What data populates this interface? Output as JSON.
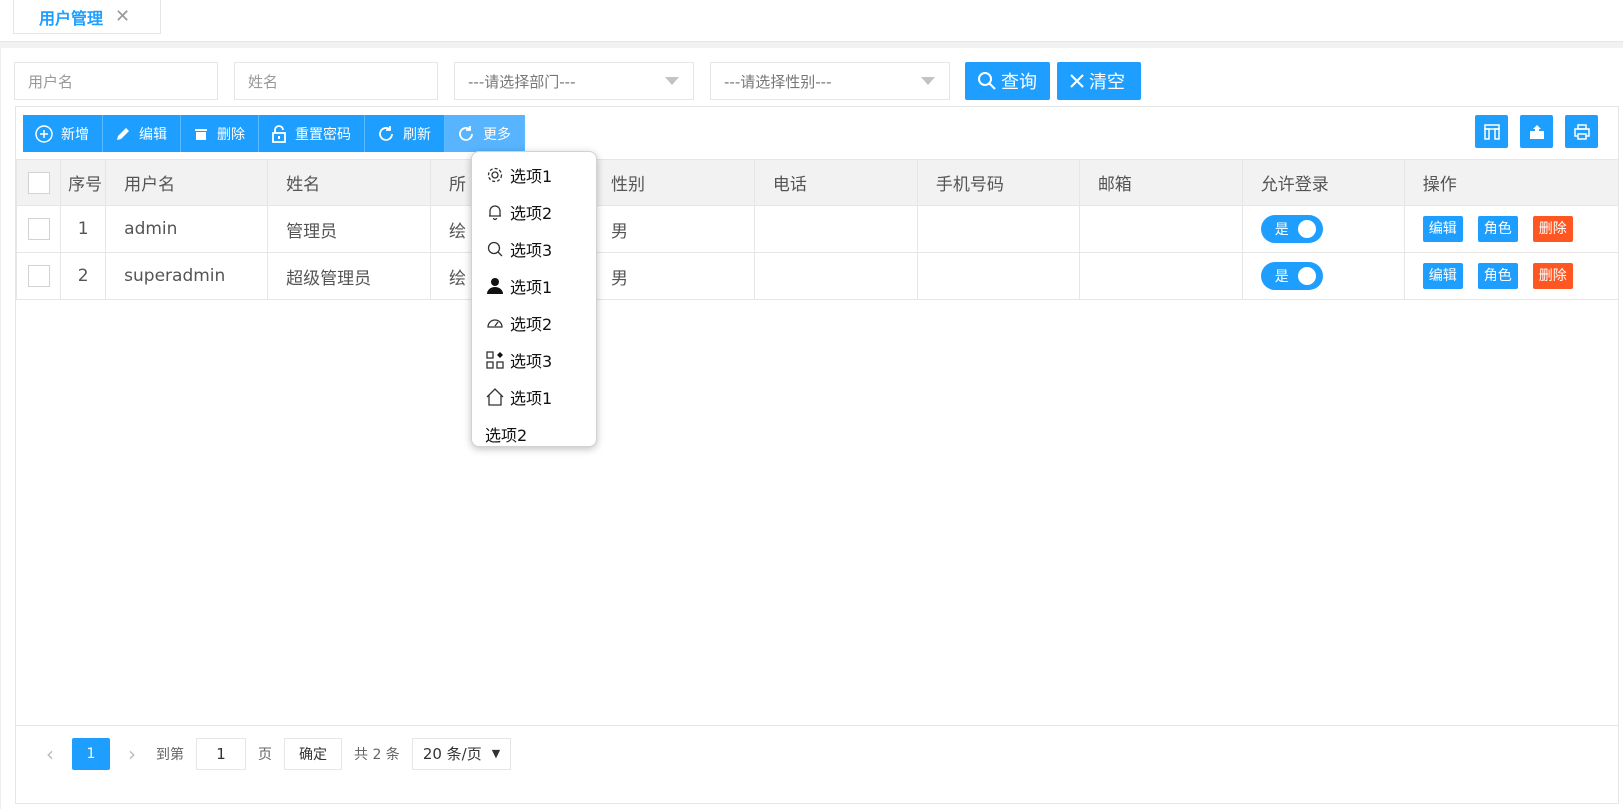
{
  "tabs": [
    {
      "label": "用户管理",
      "close": "✕"
    }
  ],
  "filters": {
    "username_placeholder": "用户名",
    "name_placeholder": "姓名",
    "department_select": "---请选择部门---",
    "gender_select": "---请选择性别---",
    "query_label": "查询",
    "clear_label": "清空"
  },
  "toolbar": {
    "add": "新增",
    "edit": "编辑",
    "delete": "删除",
    "reset_pwd": "重置密码",
    "refresh": "刷新",
    "more": "更多"
  },
  "table": {
    "headers": [
      "序号",
      "用户名",
      "姓名",
      "所",
      "性别",
      "电话",
      "手机号码",
      "邮箱",
      "允许登录",
      "操作"
    ],
    "rows": [
      {
        "index": "1",
        "username": "admin",
        "name": "管理员",
        "dept": "绘",
        "gender": "男",
        "phone": "",
        "mobile": "",
        "email": "",
        "login": "是"
      },
      {
        "index": "2",
        "username": "superadmin",
        "name": "超级管理员",
        "dept": "绘",
        "gender": "男",
        "phone": "",
        "mobile": "",
        "email": "",
        "login": "是"
      }
    ],
    "op_edit": "编辑",
    "op_role": "角色",
    "op_delete": "删除"
  },
  "dropdown": [
    {
      "icon": "gear-icon",
      "label": "选项1"
    },
    {
      "icon": "bell-icon",
      "label": "选项2"
    },
    {
      "icon": "search-icon",
      "label": "选项3"
    },
    {
      "icon": "user-icon",
      "label": "选项1"
    },
    {
      "icon": "gauge-icon",
      "label": "选项2"
    },
    {
      "icon": "apps-icon",
      "label": "选项3"
    },
    {
      "icon": "home-icon",
      "label": "选项1"
    },
    {
      "icon": "",
      "label": "选项2"
    }
  ],
  "pager": {
    "current": "1",
    "goto_label": "到第",
    "page_value": "1",
    "page_label": "页",
    "confirm": "确定",
    "total": "共 2 条",
    "size": "20 条/页"
  },
  "colors": {
    "primary": "#1e9fff",
    "danger": "#ff5722"
  }
}
